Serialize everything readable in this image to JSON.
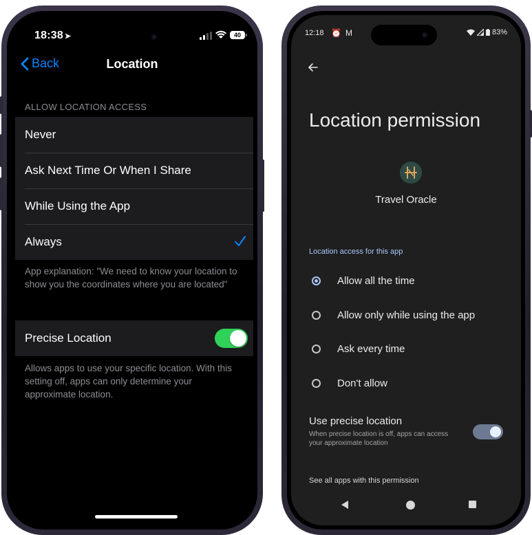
{
  "ios": {
    "status": {
      "time": "18:38",
      "battery": "40"
    },
    "nav": {
      "back_label": "Back",
      "title": "Location"
    },
    "section_header": "ALLOW LOCATION ACCESS",
    "options": [
      {
        "label": "Never",
        "selected": false
      },
      {
        "label": "Ask Next Time Or When I Share",
        "selected": false
      },
      {
        "label": "While Using the App",
        "selected": false
      },
      {
        "label": "Always",
        "selected": true
      }
    ],
    "explanation": "App explanation: \"We need to know your location to show you the coordinates where you are located\"",
    "precise": {
      "label": "Precise Location",
      "enabled": true,
      "footer": "Allows apps to use your specific location. With this setting off, apps can only determine your approximate location."
    },
    "accent_color": "#0a84ff",
    "toggle_color": "#30d158"
  },
  "android": {
    "status": {
      "time": "12:18",
      "battery": "83%"
    },
    "headline": "Location permission",
    "app_icon": "travel-oracle-logo",
    "app_name": "Travel Oracle",
    "section_label": "Location access for this app",
    "options": [
      {
        "label": "Allow all the time",
        "selected": true
      },
      {
        "label": "Allow only while using the app",
        "selected": false
      },
      {
        "label": "Ask every time",
        "selected": false
      },
      {
        "label": "Don't allow",
        "selected": false
      }
    ],
    "precise": {
      "title": "Use precise location",
      "subtitle": "When precise location is off, apps can access your approximate location",
      "enabled": true
    },
    "see_all": "See all apps with this permission",
    "accent_color": "#a8c7fa"
  }
}
